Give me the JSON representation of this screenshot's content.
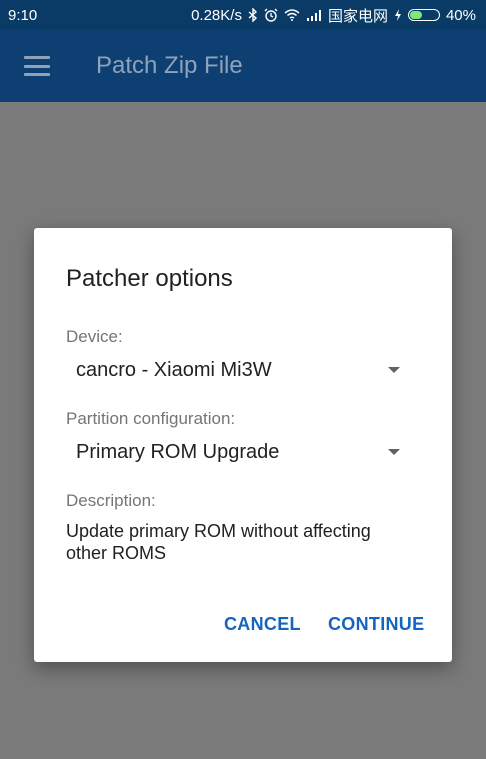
{
  "status_bar": {
    "time": "9:10",
    "net_speed": "0.28K/s",
    "carrier": "国家电网",
    "battery_percent": "40%",
    "battery_level": 0.4
  },
  "app_bar": {
    "title": "Patch Zip File"
  },
  "dialog": {
    "title": "Patcher options",
    "device_label": "Device:",
    "device_value": "cancro - Xiaomi Mi3W",
    "partition_label": "Partition configuration:",
    "partition_value": "Primary ROM Upgrade",
    "description_label": "Description:",
    "description_text": "Update primary ROM without affecting other ROMS",
    "cancel_label": "CANCEL",
    "continue_label": "CONTINUE"
  },
  "colors": {
    "app_bar": "#0d3f73",
    "accent": "#1565c0",
    "scrim": "#7a7a7a"
  }
}
